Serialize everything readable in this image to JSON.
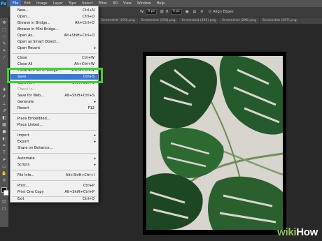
{
  "menubar": {
    "app_icon": "Ps",
    "items": [
      "File",
      "Edit",
      "Image",
      "Layer",
      "Type",
      "Select",
      "Filter",
      "3D",
      "View",
      "Window",
      "Help"
    ]
  },
  "options_bar": {
    "w_label": "W:",
    "w_value": "0 px",
    "h_label": "H:",
    "h_value": "0 px",
    "align_edges": "Align Edges"
  },
  "tabs": [
    "Screenshot (293).png",
    "Screenshot (294).png",
    "Screenshot (295).png",
    "Screenshot (296).png",
    "Screenshot (297).png"
  ],
  "file_menu": {
    "items": [
      {
        "label": "New...",
        "shortcut": "Ctrl+N"
      },
      {
        "label": "Open...",
        "shortcut": "Ctrl+O"
      },
      {
        "label": "Browse in Bridge...",
        "shortcut": "Alt+Ctrl+O"
      },
      {
        "label": "Browse in Mini Bridge...",
        "shortcut": ""
      },
      {
        "label": "Open As...",
        "shortcut": "Alt+Shift+Ctrl+O"
      },
      {
        "label": "Open as Smart Object...",
        "shortcut": ""
      },
      {
        "label": "Open Recent",
        "shortcut": "▸"
      },
      {
        "label": "Close",
        "shortcut": "Ctrl+W"
      },
      {
        "label": "Close All",
        "shortcut": "Alt+Ctrl+W"
      },
      {
        "label": "Close and Go to Bridge...",
        "shortcut": "Shift+Ctrl+W"
      },
      {
        "label": "Save",
        "shortcut": "Ctrl+S"
      },
      {
        "label": "Save As...",
        "shortcut": "Shift+Ctrl+S"
      },
      {
        "label": "Check In...",
        "shortcut": ""
      },
      {
        "label": "Save for Web...",
        "shortcut": "Alt+Shift+Ctrl+S"
      },
      {
        "label": "Generate",
        "shortcut": "▸"
      },
      {
        "label": "Revert",
        "shortcut": "F12"
      },
      {
        "label": "Place Embedded...",
        "shortcut": ""
      },
      {
        "label": "Place Linked...",
        "shortcut": ""
      },
      {
        "label": "Import",
        "shortcut": "▸"
      },
      {
        "label": "Export",
        "shortcut": "▸"
      },
      {
        "label": "Share on Behance...",
        "shortcut": ""
      },
      {
        "label": "Automate",
        "shortcut": "▸"
      },
      {
        "label": "Scripts",
        "shortcut": "▸"
      },
      {
        "label": "File Info...",
        "shortcut": "Alt+Shift+Ctrl+I"
      },
      {
        "label": "Print...",
        "shortcut": "Ctrl+P"
      },
      {
        "label": "Print One Copy",
        "shortcut": "Alt+Shift+Ctrl+P"
      },
      {
        "label": "Exit",
        "shortcut": "Ctrl+Q"
      }
    ]
  },
  "watermark": {
    "prefix": "wiki",
    "suffix": "How"
  },
  "colors": {
    "highlight": "#36d62c",
    "selection": "#3a78d8",
    "menu_bg": "#f0f0f0"
  }
}
